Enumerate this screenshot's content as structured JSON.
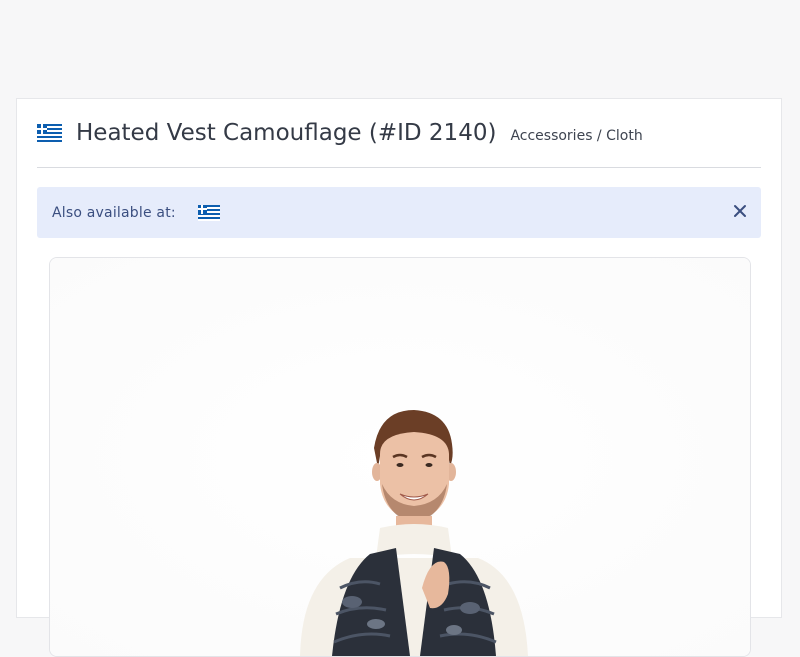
{
  "product": {
    "title": "Heated Vest Camouflage (#ID 2140)",
    "category": "Accessories / Cloth",
    "flag_icon": "greek-flag-icon"
  },
  "availability": {
    "label": "Also available at:",
    "flag_icon": "greek-flag-icon",
    "close_icon": "close-icon"
  },
  "colors": {
    "alert_bg": "#e6ecfb",
    "alert_text": "#3b4f80",
    "flag_blue": "#0d5eaf"
  }
}
